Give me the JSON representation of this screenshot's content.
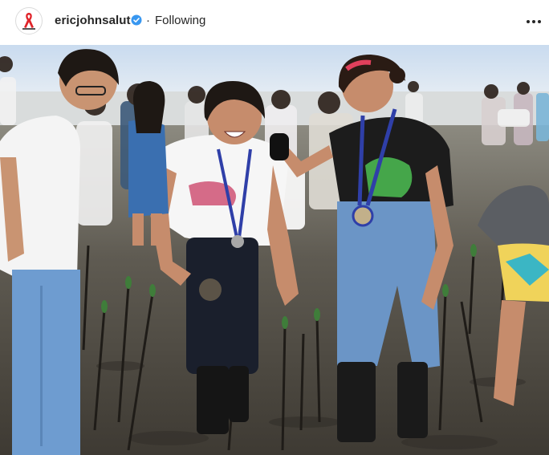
{
  "post": {
    "username": "ericjohnsalut",
    "separator": "·",
    "follow_status": "Following",
    "avatar_icon": "red-ribbon-logo",
    "verified_icon": "verified-badge-icon",
    "more_icon": "more-options-icon"
  },
  "colors": {
    "verified": "#3897f0",
    "text": "#262626",
    "ribbon": "#e0242a"
  }
}
